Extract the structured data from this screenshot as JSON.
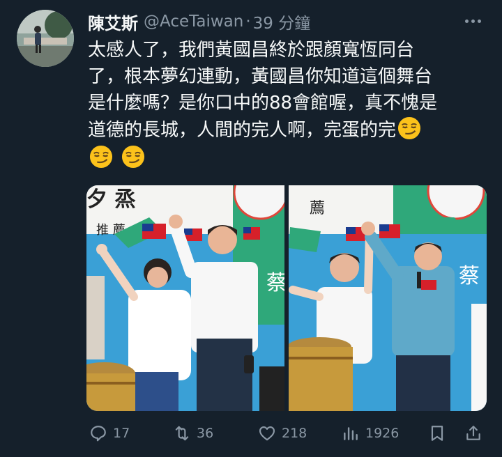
{
  "tweet": {
    "display_name": "陳艾斯",
    "handle": "@AceTaiwan",
    "separator": "·",
    "timestamp": "39 分鐘",
    "lines": [
      "太感人了，我們黃國昌終於跟顏寬恆同台",
      "了，根本夢幻連動，黃國昌你知道這個舞台",
      "是什麼嗎？是你口中的88會館喔，真不愧是",
      "道德的長城，人間的完人啊，完蛋的完"
    ],
    "emoji_name": "smirking-face-emoji"
  },
  "media": {
    "photo_left": {
      "sign_text": "推 薦",
      "vertical_text": "蔡"
    },
    "photo_right": {
      "sign_text": "薦",
      "vertical_text": "蔡"
    }
  },
  "actions": {
    "reply_count": "17",
    "retweet_count": "36",
    "like_count": "218",
    "views_count": "1926"
  },
  "colors": {
    "background": "#15202b",
    "text_primary": "#f7f9f9",
    "text_secondary": "#8b98a5",
    "party_green": "#2fa87a"
  }
}
